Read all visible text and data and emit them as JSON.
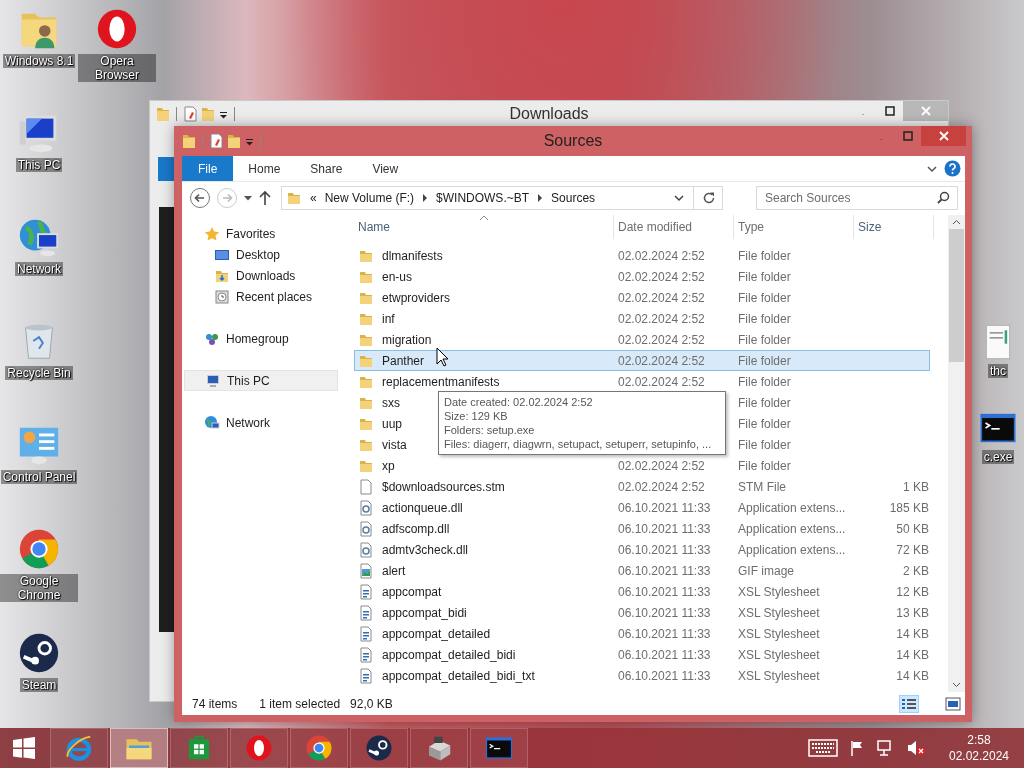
{
  "desktop_icons": [
    {
      "label": "Windows 8.1",
      "kind": "user-folder"
    },
    {
      "label": "Opera Browser",
      "kind": "opera"
    },
    {
      "label": "This PC",
      "kind": "computer"
    },
    {
      "label": "Network",
      "kind": "network"
    },
    {
      "label": "Recycle Bin",
      "kind": "recycle"
    },
    {
      "label": "Control Panel",
      "kind": "control-panel"
    },
    {
      "label": "Google Chrome",
      "kind": "chrome"
    },
    {
      "label": "Steam",
      "kind": "steam"
    }
  ],
  "desktop_icons_right": [
    {
      "label": "thc",
      "kind": "document"
    },
    {
      "label": "c.exe",
      "kind": "console"
    }
  ],
  "background_window": {
    "title": "Downloads"
  },
  "window": {
    "title": "Sources",
    "ribbon_tabs": [
      {
        "label": "File",
        "selected": true
      },
      {
        "label": "Home",
        "selected": false
      },
      {
        "label": "Share",
        "selected": false
      },
      {
        "label": "View",
        "selected": false
      }
    ],
    "address": {
      "prefix": "«",
      "crumbs": [
        "New Volume (F:)",
        "$WINDOWS.~BT",
        "Sources"
      ]
    },
    "search": {
      "placeholder": "Search Sources"
    },
    "nav": [
      {
        "label": "Favorites",
        "kind": "favorites",
        "selected": false,
        "children": [
          {
            "label": "Desktop",
            "kind": "desktop",
            "selected": false
          },
          {
            "label": "Downloads",
            "kind": "downloads",
            "selected": false
          },
          {
            "label": "Recent places",
            "kind": "recent",
            "selected": false
          }
        ]
      },
      {
        "label": "Homegroup",
        "kind": "homegroup",
        "selected": false
      },
      {
        "label": "This PC",
        "kind": "computer",
        "selected": true
      },
      {
        "label": "Network",
        "kind": "network",
        "selected": false
      }
    ],
    "columns": [
      "Name",
      "Date modified",
      "Type",
      "Size"
    ],
    "files": [
      {
        "name": "dlmanifests",
        "kind": "folder",
        "date": "02.02.2024 2:52",
        "type": "File folder",
        "selected": false
      },
      {
        "name": "en-us",
        "kind": "folder",
        "date": "02.02.2024 2:52",
        "type": "File folder",
        "selected": false
      },
      {
        "name": "etwproviders",
        "kind": "folder",
        "date": "02.02.2024 2:52",
        "type": "File folder",
        "selected": false
      },
      {
        "name": "inf",
        "kind": "folder",
        "date": "02.02.2024 2:52",
        "type": "File folder",
        "selected": false
      },
      {
        "name": "migration",
        "kind": "folder",
        "date": "02.02.2024 2:52",
        "type": "File folder",
        "selected": false
      },
      {
        "name": "Panther",
        "kind": "folder",
        "date": "02.02.2024 2:52",
        "type": "File folder",
        "selected": true
      },
      {
        "name": "replacementmanifests",
        "kind": "folder",
        "date": "02.02.2024 2:52",
        "type": "File folder",
        "selected": false
      },
      {
        "name": "sxs",
        "kind": "folder",
        "type": "File folder",
        "selected": false
      },
      {
        "name": "uup",
        "kind": "folder",
        "type": "File folder",
        "selected": false
      },
      {
        "name": "vista",
        "kind": "folder",
        "type": "File folder",
        "selected": false
      },
      {
        "name": "xp",
        "kind": "folder",
        "date": "02.02.2024 2:52",
        "type": "File folder",
        "selected": false
      },
      {
        "name": "$downloadsources.stm",
        "kind": "file",
        "date": "02.02.2024 2:52",
        "type": "STM File",
        "size": "1 KB",
        "selected": false
      },
      {
        "name": "actionqueue.dll",
        "kind": "dll",
        "date": "06.10.2021 11:33",
        "type": "Application extens...",
        "size": "185 KB",
        "selected": false
      },
      {
        "name": "adfscomp.dll",
        "kind": "dll",
        "date": "06.10.2021 11:33",
        "type": "Application extens...",
        "size": "50 KB",
        "selected": false
      },
      {
        "name": "admtv3check.dll",
        "kind": "dll",
        "date": "06.10.2021 11:33",
        "type": "Application extens...",
        "size": "72 KB",
        "selected": false
      },
      {
        "name": "alert",
        "kind": "image",
        "date": "06.10.2021 11:33",
        "type": "GIF image",
        "size": "2 KB",
        "selected": false
      },
      {
        "name": "appcompat",
        "kind": "stylesheet",
        "date": "06.10.2021 11:33",
        "type": "XSL Stylesheet",
        "size": "12 KB",
        "selected": false
      },
      {
        "name": "appcompat_bidi",
        "kind": "stylesheet",
        "date": "06.10.2021 11:33",
        "type": "XSL Stylesheet",
        "size": "13 KB",
        "selected": false
      },
      {
        "name": "appcompat_detailed",
        "kind": "stylesheet",
        "date": "06.10.2021 11:33",
        "type": "XSL Stylesheet",
        "size": "14 KB",
        "selected": false
      },
      {
        "name": "appcompat_detailed_bidi",
        "kind": "stylesheet",
        "date": "06.10.2021 11:33",
        "type": "XSL Stylesheet",
        "size": "14 KB",
        "selected": false
      },
      {
        "name": "appcompat_detailed_bidi_txt",
        "kind": "stylesheet",
        "date": "06.10.2021 11:33",
        "type": "XSL Stylesheet",
        "size": "14 KB",
        "selected": false
      }
    ],
    "tooltip": [
      "Date created: 02.02.2024 2:52",
      "Size: 129 KB",
      "Folders: setup.exe",
      "Files: diagerr, diagwrn, setupact, setuperr, setupinfo, ..."
    ],
    "status": {
      "count": "74 items",
      "selection": "1 item selected",
      "selection_size": "92,0 KB"
    },
    "views": [
      {
        "kind": "details",
        "selected": true
      },
      {
        "kind": "large-icons",
        "selected": false
      }
    ]
  },
  "taskbar": {
    "apps": [
      {
        "kind": "ie",
        "selected": false
      },
      {
        "kind": "explorer",
        "selected": true
      },
      {
        "kind": "store",
        "selected": false
      },
      {
        "kind": "opera",
        "selected": false
      },
      {
        "kind": "chrome",
        "selected": false
      },
      {
        "kind": "steam",
        "selected": false
      },
      {
        "kind": "drive-tool",
        "selected": false
      },
      {
        "kind": "console",
        "selected": false
      }
    ],
    "clock": {
      "time": "2:58",
      "date": "02.02.2024"
    }
  }
}
